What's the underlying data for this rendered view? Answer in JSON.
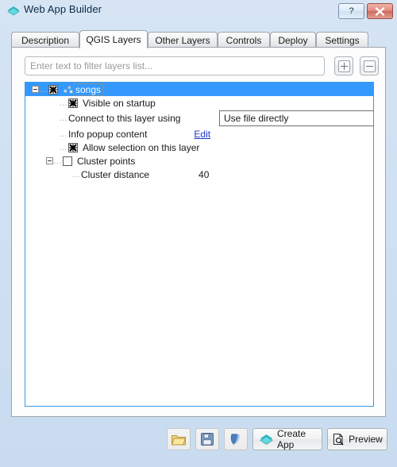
{
  "window": {
    "title": "Web App Builder",
    "icon": "diamond-logo-icon",
    "help_label": "?",
    "close_label": "✕",
    "accent_color": "#3399ff",
    "logo_color": "#3fd1d9"
  },
  "tabs": [
    {
      "label": "Description",
      "active": false
    },
    {
      "label": "QGIS Layers",
      "active": true
    },
    {
      "label": "Other Layers",
      "active": false
    },
    {
      "label": "Controls",
      "active": false
    },
    {
      "label": "Deploy",
      "active": false
    },
    {
      "label": "Settings",
      "active": false
    }
  ],
  "filter": {
    "placeholder": "Enter text to filter layers list...",
    "value": "",
    "add_label": "+",
    "remove_label": "−"
  },
  "tree": {
    "layer": {
      "name": "songs",
      "checked": true,
      "expanded": true,
      "selected": true,
      "geometry_icon": "point-layer-icon"
    },
    "properties": [
      {
        "type": "checkbox",
        "label": "Visible on startup",
        "checked": true
      },
      {
        "type": "combo",
        "label": "Connect to this layer using",
        "value": "Use file directly"
      },
      {
        "type": "link",
        "label": "Info popup content",
        "link_text": "Edit"
      },
      {
        "type": "checkbox",
        "label": "Allow selection on this layer",
        "checked": true
      },
      {
        "type": "checkbox-parent",
        "label": "Cluster points",
        "checked": false,
        "expanded": true
      },
      {
        "type": "value",
        "label": "Cluster distance",
        "value": "40"
      }
    ]
  },
  "bottom_bar": {
    "open_label": "",
    "open_icon": "open-folder-icon",
    "save_label": "",
    "save_icon": "floppy-save-icon",
    "qgis_label": "",
    "qgis_icon": "qgis-logo-icon",
    "create_app_label": "Create App",
    "create_app_icon": "diamond-logo-icon",
    "preview_label": "Preview",
    "preview_icon": "document-magnifier-icon"
  }
}
